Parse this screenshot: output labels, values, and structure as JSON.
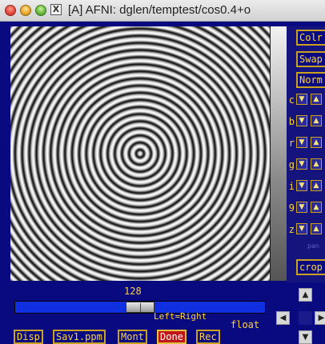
{
  "window": {
    "title": "[A] AFNI: dglen/temptest/cos0.4+o",
    "x_icon": "X"
  },
  "colors": {
    "panel_bg": "#0a0a80",
    "button_text": "#ffd23c",
    "slider_track": "#0f2fe0",
    "done_button": "#c01818"
  },
  "menus": {
    "colr": "Colr",
    "swap": "Swap",
    "norm": "Norm"
  },
  "rows": [
    {
      "label": "c"
    },
    {
      "label": "b"
    },
    {
      "label": "r"
    },
    {
      "label": "g"
    },
    {
      "label": "i"
    },
    {
      "label": "9"
    },
    {
      "label": "z"
    }
  ],
  "crop_label": "crop",
  "slider": {
    "value": "128",
    "position_fraction": 0.5
  },
  "float_label": {
    "left_right": "Left=Right",
    "float": "float"
  },
  "bottom_buttons": {
    "disp": "Disp",
    "sav": "Sav1.ppm",
    "mont": "Mont",
    "done": "Done",
    "rec": "Rec"
  }
}
